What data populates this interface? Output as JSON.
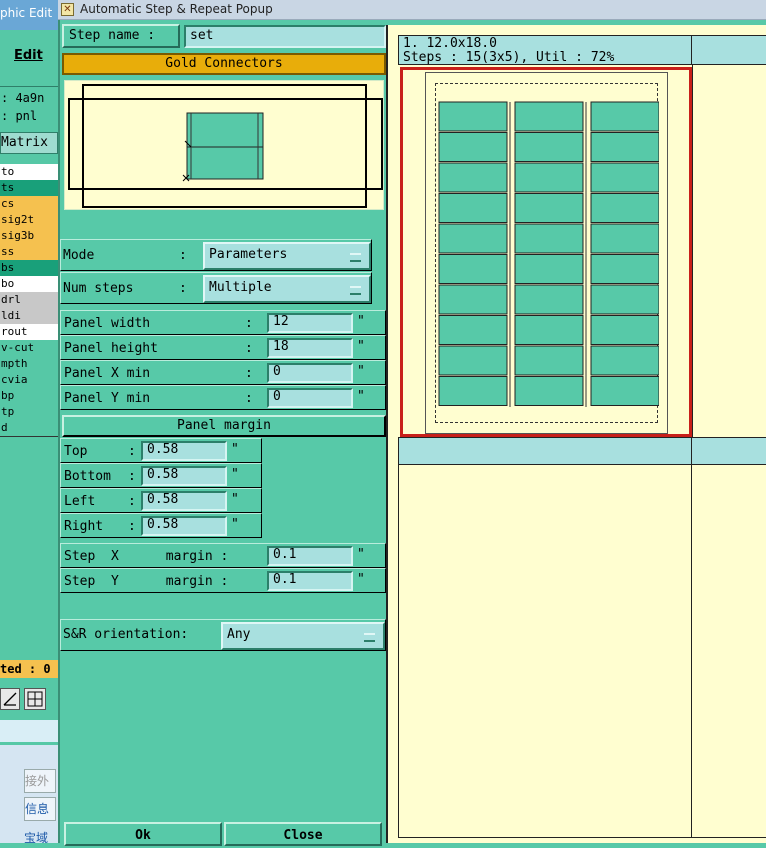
{
  "background_app": {
    "title": "phic Edit",
    "menu_edit": "Edit",
    "info": [
      ": 4a9n",
      ": pnl"
    ],
    "matrix_label": "Matrix",
    "layers": [
      {
        "name": "to",
        "color": "#ffffff"
      },
      {
        "name": "ts",
        "color": "#19a07a"
      },
      {
        "name": "cs",
        "color": "#f5c14f"
      },
      {
        "name": "sig2t",
        "color": "#f5c14f"
      },
      {
        "name": "sig3b",
        "color": "#f5c14f"
      },
      {
        "name": "ss",
        "color": "#f5c14f"
      },
      {
        "name": "bs",
        "color": "#19a07a"
      },
      {
        "name": "bo",
        "color": "#ffffff"
      },
      {
        "name": "drl",
        "color": "#c8c8c8"
      },
      {
        "name": "ldi",
        "color": "#c8c8c8"
      },
      {
        "name": "rout",
        "color": "#ffffff"
      },
      {
        "name": "v-cut",
        "color": "#56c8a6"
      },
      {
        "name": "mpth",
        "color": "#56c8a6"
      },
      {
        "name": "cvia",
        "color": "#56c8a6"
      },
      {
        "name": "bp",
        "color": "#56c8a6"
      },
      {
        "name": "tp",
        "color": "#56c8a6"
      },
      {
        "name": "d",
        "color": "#56c8a6"
      }
    ],
    "selected_text": "ted : 0",
    "bottom_labels": [
      "接外",
      "信息",
      "宝域网"
    ]
  },
  "window": {
    "title": "Automatic Step & Repeat Popup"
  },
  "step_name": {
    "label": "Step name :",
    "value": "set"
  },
  "profile_title": "Gold Connectors",
  "mode": {
    "label": "Mode",
    "sep": ":",
    "value": "Parameters"
  },
  "num_steps": {
    "label": "Num steps",
    "sep": ":",
    "value": "Multiple"
  },
  "panel_fields": [
    {
      "label": "Panel width",
      "value": "12",
      "unit": "\""
    },
    {
      "label": "Panel height",
      "value": "18",
      "unit": "\""
    },
    {
      "label": "Panel X min",
      "value": "0",
      "unit": "\""
    },
    {
      "label": "Panel Y min",
      "value": "0",
      "unit": "\""
    }
  ],
  "panel_margin": {
    "title": "Panel margin",
    "fields": [
      {
        "label": "Top",
        "value": "0.58",
        "unit": "\""
      },
      {
        "label": "Bottom",
        "value": "0.58",
        "unit": "\""
      },
      {
        "label": "Left",
        "value": "0.58",
        "unit": "\""
      },
      {
        "label": "Right",
        "value": "0.58",
        "unit": "\""
      }
    ]
  },
  "step_margins": [
    {
      "label": "Step  X      margin :",
      "value": "0.1",
      "unit": "\""
    },
    {
      "label": "Step  Y      margin :",
      "value": "0.1",
      "unit": "\""
    }
  ],
  "orientation": {
    "label": "S&R orientation:",
    "value": "Any"
  },
  "buttons": {
    "ok": "Ok",
    "close": "Close"
  },
  "result": {
    "line1": "1.  12.0x18.0",
    "line2": "Steps : 15(3x5), Util : 72%",
    "columns": 3,
    "rows": 10
  },
  "colors": {
    "dialog_bg": "#57c9a8",
    "field_bg": "#a8e0df",
    "profile_title_bg": "#e8ad0a",
    "preview_bg": "#fffed0",
    "selection_border": "#c8201a"
  }
}
